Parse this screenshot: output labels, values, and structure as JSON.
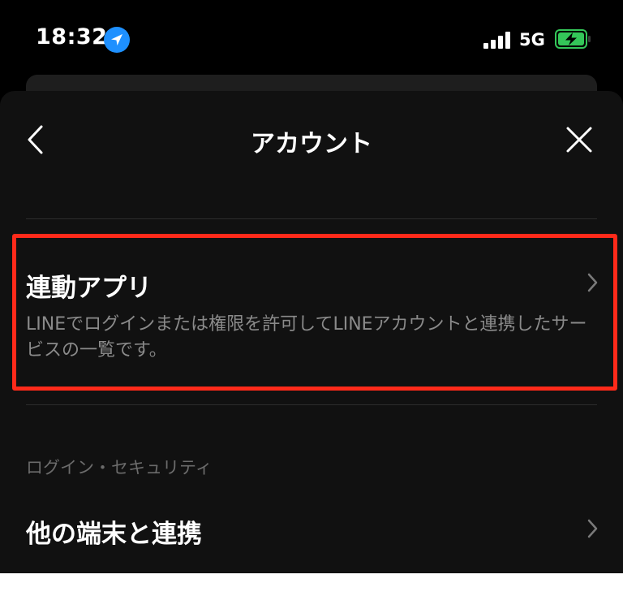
{
  "status_bar": {
    "time": "18:32",
    "network": "5G",
    "icons": [
      "location-arrow-icon",
      "signal-bars-icon",
      "battery-charging-icon"
    ],
    "battery_color": "#34c759"
  },
  "header": {
    "title": "アカウント",
    "back_icon": "chevron-left-icon",
    "close_icon": "close-icon"
  },
  "linked_apps": {
    "title": "連動アプリ",
    "description": "LINEでログインまたは権限を許可してLINEアカウントと連携したサービスの一覧です。"
  },
  "login_security": {
    "section_title": "ログイン・セキュリティ",
    "items": [
      {
        "label": "他の端末と連携"
      }
    ]
  },
  "colors": {
    "background": "#000000",
    "sheet": "#111111",
    "highlight": "#ff2a1a",
    "secondary_text": "#8a8a8a"
  }
}
